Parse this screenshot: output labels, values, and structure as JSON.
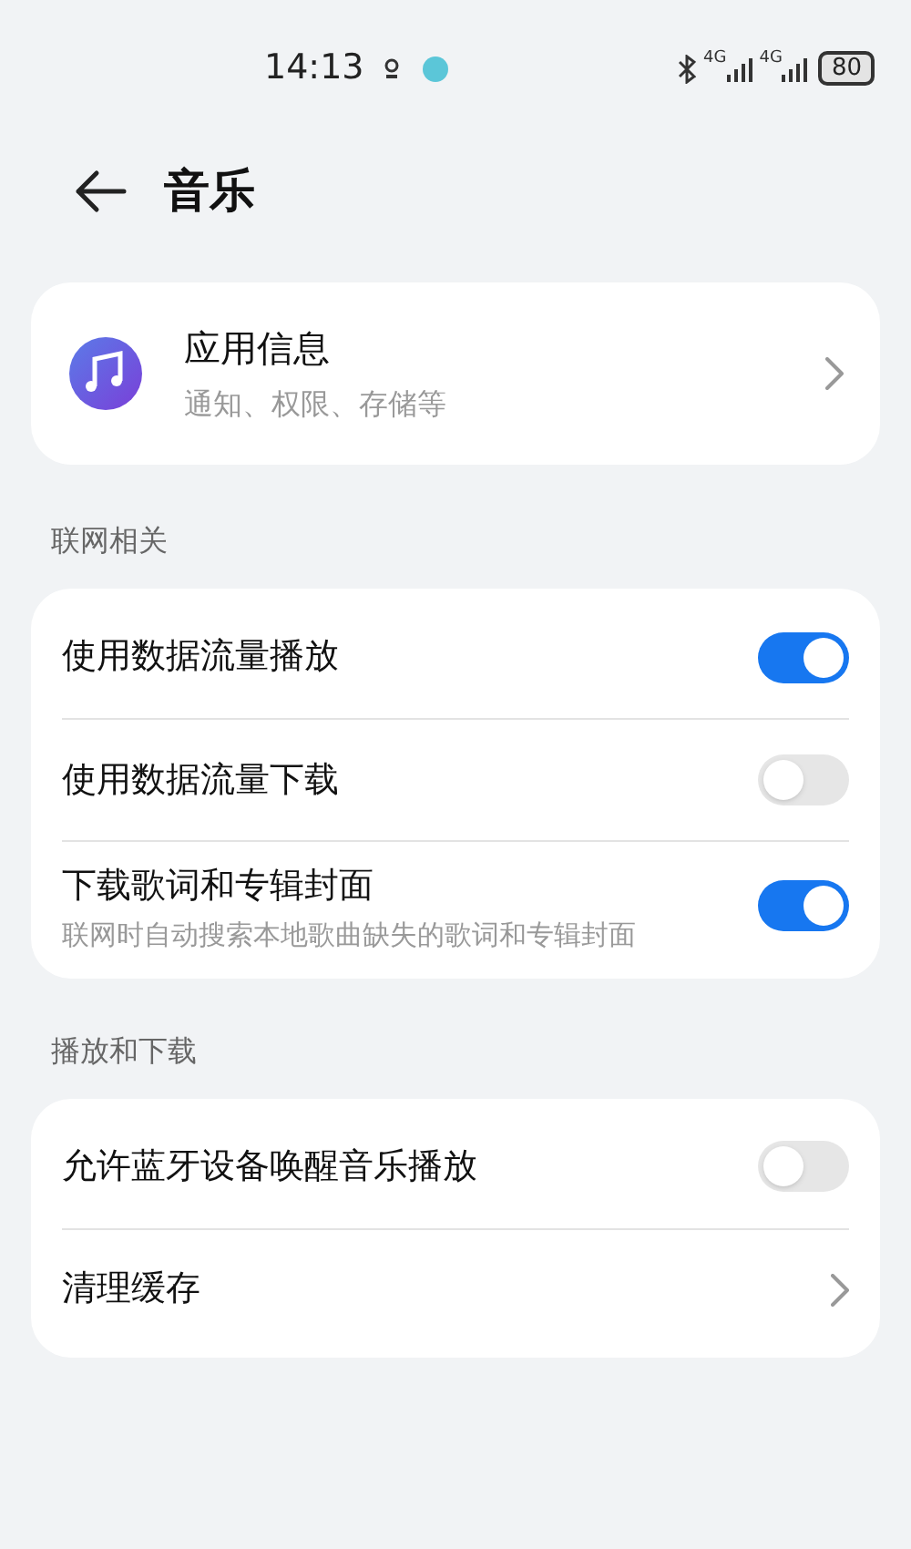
{
  "status_bar": {
    "time": "14:13",
    "networks": [
      "4G",
      "4G"
    ],
    "battery": "80"
  },
  "header": {
    "title": "音乐"
  },
  "app_info": {
    "title": "应用信息",
    "subtitle": "通知、权限、存储等"
  },
  "sections": [
    {
      "title": "联网相关",
      "items": [
        {
          "kind": "toggle",
          "label": "使用数据流量播放",
          "on": true
        },
        {
          "kind": "toggle",
          "label": "使用数据流量下载",
          "on": false
        },
        {
          "kind": "toggle",
          "label": "下载歌词和专辑封面",
          "subtitle": "联网时自动搜索本地歌曲缺失的歌词和专辑封面",
          "on": true
        }
      ]
    },
    {
      "title": "播放和下载",
      "items": [
        {
          "kind": "toggle",
          "label": "允许蓝牙设备唤醒音乐播放",
          "on": false
        },
        {
          "kind": "link",
          "label": "清理缓存"
        }
      ]
    }
  ]
}
